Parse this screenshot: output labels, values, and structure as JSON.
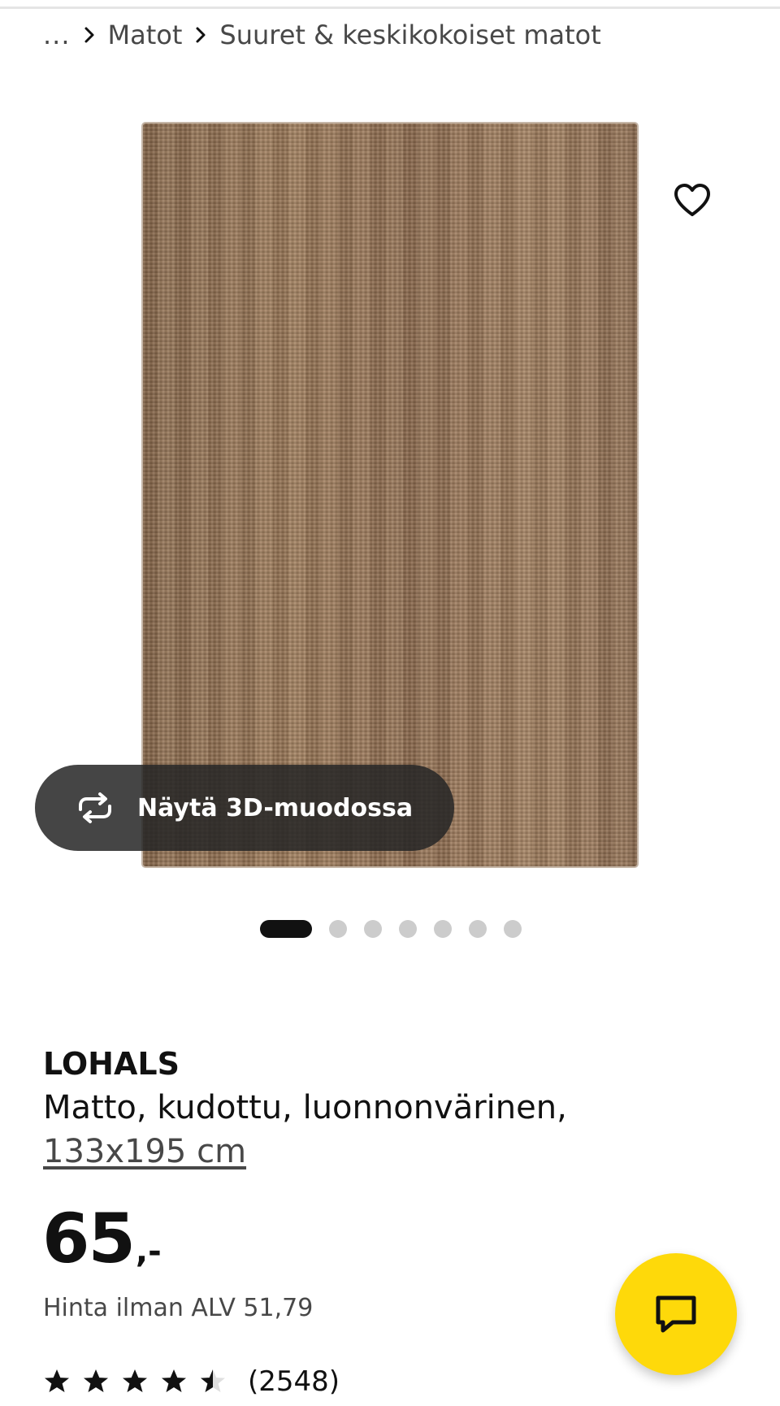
{
  "breadcrumb": {
    "more": "...",
    "items": [
      "Matot",
      "Suuret & keskikokoiset matot"
    ]
  },
  "media": {
    "favourite_icon": "heart-outline-icon",
    "view3d_icon": "rotate-arrows-icon",
    "view3d_label": "Näytä 3D-muodossa",
    "carousel": {
      "total_images": 7,
      "active_index": 0
    }
  },
  "product": {
    "name": "LOHALS",
    "description": "Matto, kudottu, luonnonvärinen,",
    "size": "133x195 cm"
  },
  "price": {
    "integer": "65",
    "suffix": ",-",
    "vat_text": "Hinta ilman ALV 51,79"
  },
  "rating": {
    "stars": 4.5,
    "max": 5,
    "count": "(2548)"
  },
  "chat": {
    "icon": "chat-bubble-icon"
  },
  "colors": {
    "accent_yellow": "#fed90a",
    "text_primary": "#111111",
    "text_secondary": "#484848",
    "dot_inactive": "#cccccc",
    "button_dark": "#262626"
  }
}
